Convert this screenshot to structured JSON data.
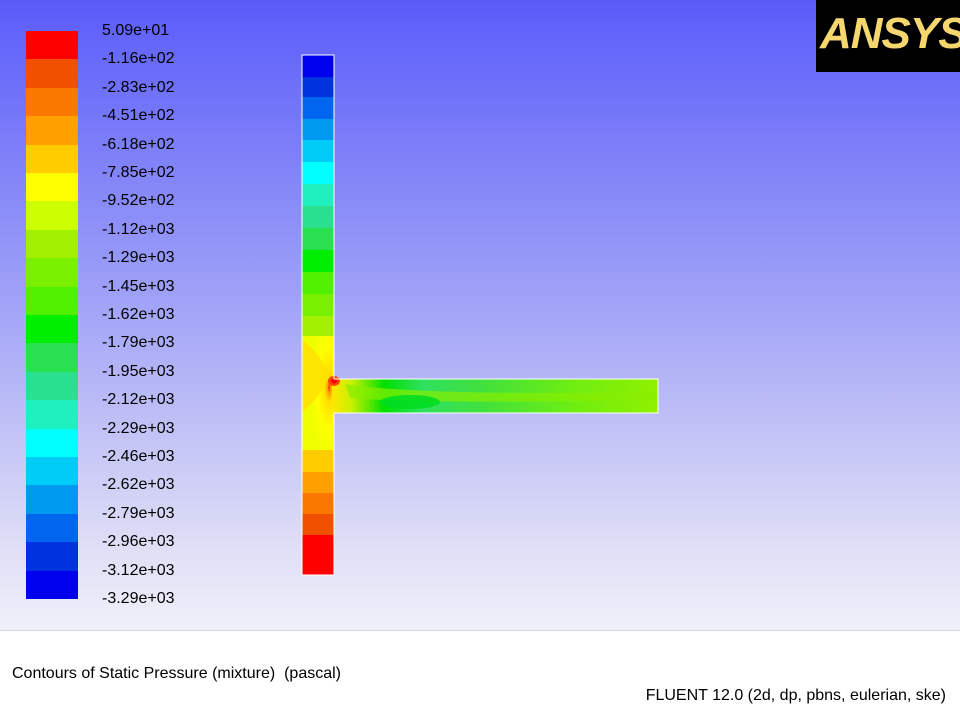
{
  "colorbar": {
    "labels": [
      "5.09e+01",
      "-1.16e+02",
      "-2.83e+02",
      "-4.51e+02",
      "-6.18e+02",
      "-7.85e+02",
      "-9.52e+02",
      "-1.12e+03",
      "-1.29e+03",
      "-1.45e+03",
      "-1.62e+03",
      "-1.79e+03",
      "-1.95e+03",
      "-2.12e+03",
      "-2.29e+03",
      "-2.46e+03",
      "-2.62e+03",
      "-2.79e+03",
      "-2.96e+03",
      "-3.12e+03",
      "-3.29e+03"
    ],
    "colors": [
      "#ff0000",
      "#f05000",
      "#fa7800",
      "#ffa000",
      "#ffcc00",
      "#ffff00",
      "#ccff00",
      "#a0f000",
      "#78f000",
      "#50f000",
      "#00ee00",
      "#28e050",
      "#28e090",
      "#20f0c0",
      "#00ffff",
      "#00ccf8",
      "#0099f0",
      "#0066f0",
      "#0033e0",
      "#0000ee"
    ]
  },
  "logo": {
    "text": "ANSYS"
  },
  "caption": {
    "title": "Contours of Static Pressure (mixture)  (pascal)",
    "solver": "FLUENT 12.0 (2d, dp, pbns, eulerian, ske)"
  },
  "colors": {
    "background_top": "#5a5cfa",
    "background_bottom": "#f0f0fa",
    "logo_bg": "#000000"
  }
}
